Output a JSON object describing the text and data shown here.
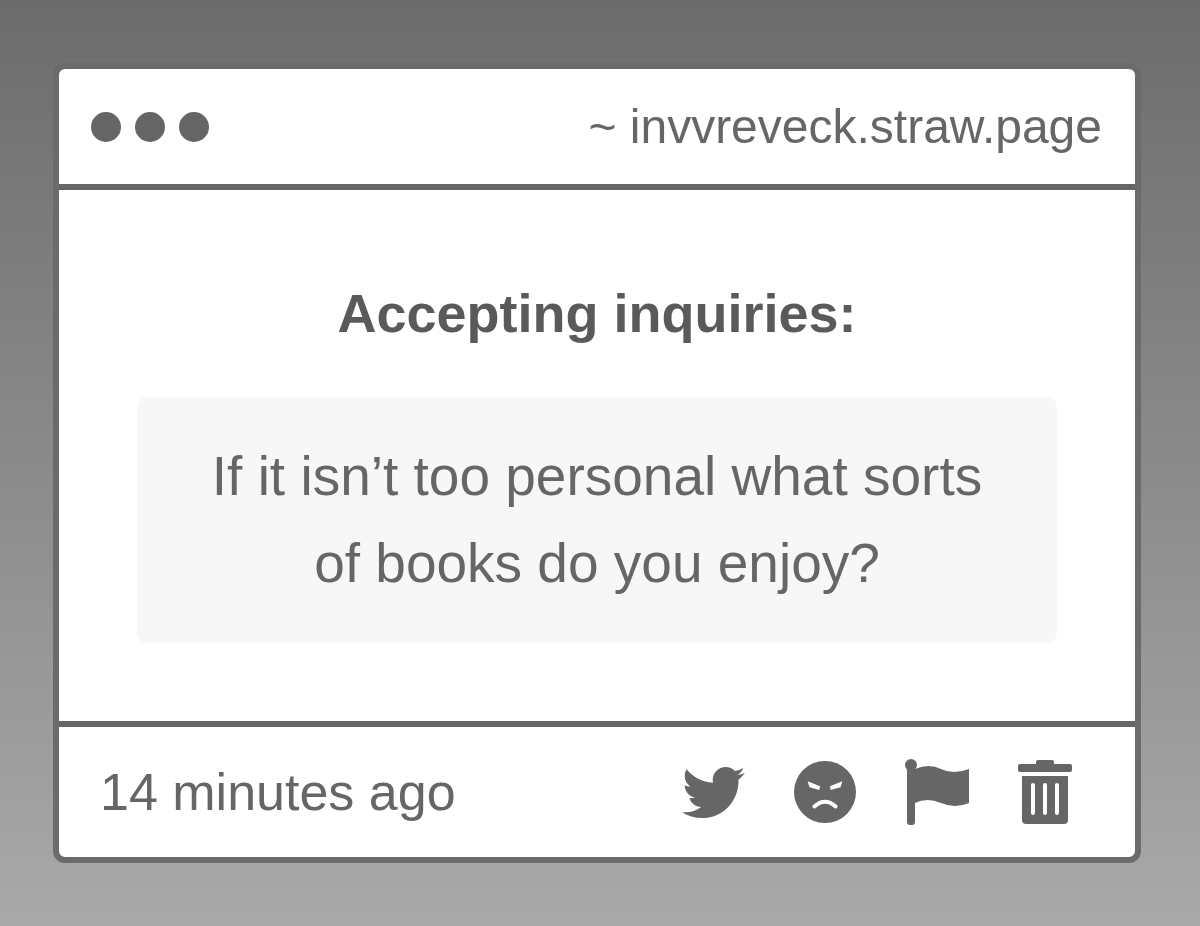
{
  "window": {
    "url": "~ invvreveck.straw.page"
  },
  "post": {
    "heading": "Accepting inquiries:",
    "question": "If it isn’t too personal what sorts of books do you enjoy?"
  },
  "footer": {
    "timestamp": "14 minutes ago"
  }
}
